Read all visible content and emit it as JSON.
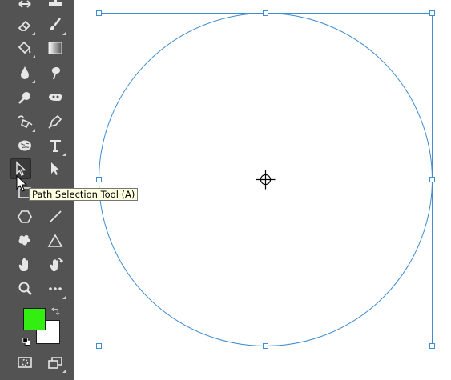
{
  "tooltip": {
    "text": "Path Selection Tool (A)"
  },
  "colors": {
    "toolbar_bg": "#535353",
    "selection_blue": "#3f8ccf",
    "foreground": "#33ee11",
    "background": "#ffffff"
  },
  "tools": [
    {
      "name": "move-tool",
      "icon": "move-icon"
    },
    {
      "name": "stamp-tool",
      "icon": "stamp-icon"
    },
    {
      "name": "eraser-tool",
      "icon": "eraser-icon"
    },
    {
      "name": "brush-tool",
      "icon": "brush-icon"
    },
    {
      "name": "paint-bucket-tool",
      "icon": "bucket-icon"
    },
    {
      "name": "gradient-tool",
      "icon": "gradient-icon"
    },
    {
      "name": "blur-tool",
      "icon": "drop-icon"
    },
    {
      "name": "smudge-tool",
      "icon": "smudge-icon"
    },
    {
      "name": "dodge-tool",
      "icon": "dodge-icon"
    },
    {
      "name": "sponge-tool",
      "icon": "sponge-icon"
    },
    {
      "name": "curvature-pen-tool",
      "icon": "curvature-pen-icon"
    },
    {
      "name": "pen-tool",
      "icon": "pen-icon"
    },
    {
      "name": "brain-tool",
      "icon": "brain-icon"
    },
    {
      "name": "type-tool",
      "icon": "type-icon"
    },
    {
      "name": "path-selection-tool",
      "icon": "path-selection-icon"
    },
    {
      "name": "direct-selection-tool",
      "icon": "direct-selection-icon"
    },
    {
      "name": "rectangle-tool",
      "icon": "rectangle-icon"
    },
    {
      "name": "hexagon-tool",
      "icon": "hexagon-icon"
    },
    {
      "name": "line-tool",
      "icon": "line-icon"
    },
    {
      "name": "custom-shape-tool",
      "icon": "custom-shape-icon"
    },
    {
      "name": "triangle-tool",
      "icon": "triangle-icon"
    },
    {
      "name": "hand-tool",
      "icon": "hand-icon"
    },
    {
      "name": "rotate-view-tool",
      "icon": "rotate-hand-icon"
    },
    {
      "name": "zoom-tool",
      "icon": "zoom-icon"
    },
    {
      "name": "more-tools",
      "icon": "ellipsis-icon"
    }
  ]
}
